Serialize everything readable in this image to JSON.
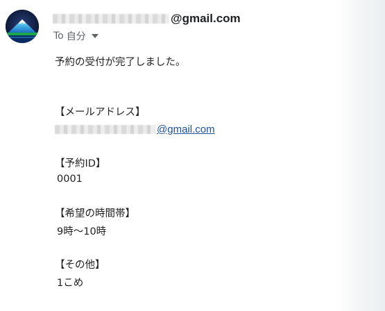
{
  "sender": {
    "domain": "@gmail.com",
    "avatar_icon": "mountain-avatar-icon"
  },
  "recipient": {
    "to_label": "To",
    "name": "自分"
  },
  "message": {
    "intro": "予約の受付が完了しました。",
    "email_heading": "【メールアドレス】",
    "email_domain": "@gmail.com",
    "reservation_id_heading": "【予約ID】",
    "reservation_id": "0001",
    "time_heading": "【希望の時間帯】",
    "time_value": "9時～10時",
    "other_heading": "【その他】",
    "other_value": "1こめ"
  },
  "colors": {
    "link": "#1a4f9c",
    "text": "#202124",
    "muted": "#5f6368"
  }
}
